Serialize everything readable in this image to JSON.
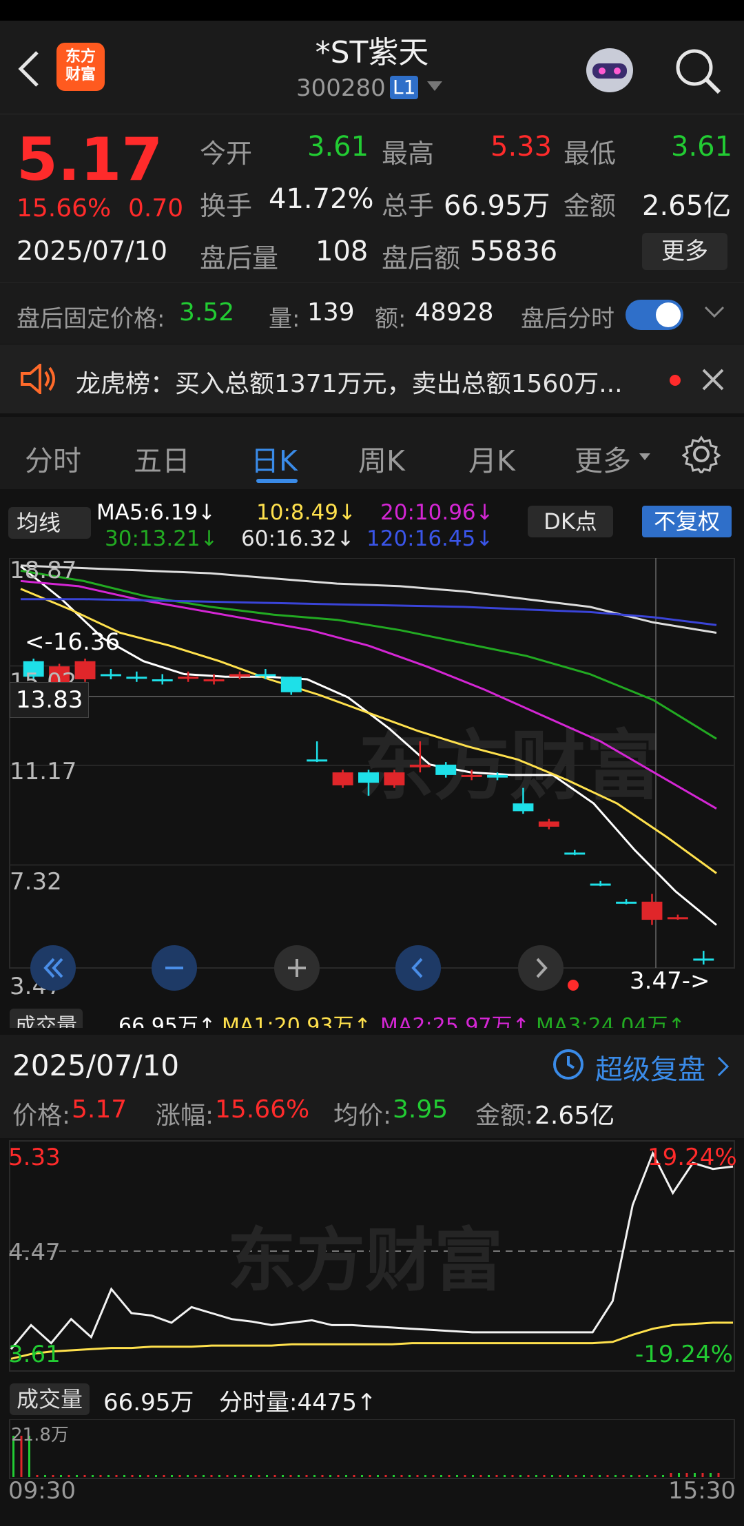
{
  "header": {
    "title": "*ST紫天",
    "code": "300280",
    "level_badge": "L1",
    "logo_text_1": "东方",
    "logo_text_2": "财富"
  },
  "quote": {
    "price": "5.17",
    "change_pct": "15.66%",
    "change_amt": "0.70",
    "date": "2025/07/10",
    "open_label": "今开",
    "open": "3.61",
    "high_label": "最高",
    "high": "5.33",
    "low_label": "最低",
    "low": "3.61",
    "turnover_label": "换手",
    "turnover": "41.72%",
    "volume_label": "总手",
    "volume": "66.95万",
    "amount_label": "金额",
    "amount": "2.65亿",
    "after_vol_label": "盘后量",
    "after_vol": "108",
    "after_amt_label": "盘后额",
    "after_amt": "55836",
    "more_button": "更多"
  },
  "after_hours": {
    "fixed_price_label": "盘后固定价格:",
    "fixed_price": "3.52",
    "vol_label": "量:",
    "vol": "139",
    "amt_label": "额:",
    "amt": "48928",
    "toggle_label": "盘后分时",
    "toggle_on": true
  },
  "notice": {
    "text": "龙虎榜：买入总额1371万元，卖出总额1560万..."
  },
  "tabs": [
    "分时",
    "五日",
    "日K",
    "周K",
    "月K",
    "更多"
  ],
  "active_tab": "日K",
  "ma_bar": {
    "selector": "均线",
    "ma5": "MA5:6.19↓",
    "ma10": "10:8.49↓",
    "ma20": "20:10.96↓",
    "ma30": "30:13.21↓",
    "ma60": "60:16.32↓",
    "ma120": "120:16.45↓",
    "dk_button": "DK点",
    "adjust_button": "不复权"
  },
  "kchart_axis": {
    "ticks": [
      "18.87",
      "15.02",
      "11.17",
      "7.32",
      "3.47"
    ],
    "crosshair_value": "13.83",
    "high_marker": "<-16.36",
    "low_marker": "3.47->"
  },
  "volume_bar": {
    "label": "成交量",
    "value": "66.95万↑",
    "ma1": "MA1:20.93万↑",
    "ma2": "MA2:25.97万↑",
    "ma3": "MA3:24.04万↑"
  },
  "intraday": {
    "date": "2025/07/10",
    "replay_label": "超级复盘",
    "price_label": "价格:",
    "price": "5.17",
    "chg_label": "涨幅:",
    "chg": "15.66%",
    "avg_label": "均价:",
    "avg": "3.95",
    "amt_label": "金额:",
    "amt": "2.65亿",
    "y_top": "5.33",
    "y_mid": "4.47",
    "y_bottom": "3.61",
    "pct_top": "19.24%",
    "pct_bottom": "-19.24%",
    "vol_label": "成交量",
    "vol": "66.95万",
    "tick_vol": "分时量:4475↑",
    "vol_max": "21.8万",
    "time_start": "09:30",
    "time_end": "15:30"
  },
  "colors": {
    "up": "#ff2b2b",
    "down": "#22cc33",
    "accent": "#3a7bd5",
    "ma5": "#ffffff",
    "ma10": "#ffe14d",
    "ma20": "#d426d4",
    "ma30": "#22aa22",
    "ma60": "#dddddd",
    "ma120": "#3a44d8"
  },
  "chart_data": {
    "type": "candlestick",
    "y_range": [
      3.47,
      18.87
    ],
    "candles": [
      {
        "o": 15.2,
        "c": 14.6,
        "h": 15.3,
        "l": 14.5,
        "dir": "down"
      },
      {
        "o": 14.3,
        "c": 15.0,
        "h": 15.1,
        "l": 14.2,
        "dir": "up"
      },
      {
        "o": 14.5,
        "c": 15.2,
        "h": 15.3,
        "l": 14.4,
        "dir": "up"
      },
      {
        "o": 14.7,
        "c": 14.7,
        "h": 14.9,
        "l": 14.5,
        "dir": "down"
      },
      {
        "o": 14.6,
        "c": 14.6,
        "h": 14.8,
        "l": 14.4,
        "dir": "down"
      },
      {
        "o": 14.5,
        "c": 14.5,
        "h": 14.7,
        "l": 14.3,
        "dir": "down"
      },
      {
        "o": 14.6,
        "c": 14.6,
        "h": 14.8,
        "l": 14.4,
        "dir": "up"
      },
      {
        "o": 14.5,
        "c": 14.5,
        "h": 14.7,
        "l": 14.3,
        "dir": "up"
      },
      {
        "o": 14.6,
        "c": 14.7,
        "h": 14.8,
        "l": 14.5,
        "dir": "up"
      },
      {
        "o": 14.7,
        "c": 14.7,
        "h": 14.9,
        "l": 14.5,
        "dir": "down"
      },
      {
        "o": 14.6,
        "c": 14.0,
        "h": 14.6,
        "l": 13.9,
        "dir": "down"
      },
      {
        "o": 11.4,
        "c": 11.4,
        "h": 12.1,
        "l": 11.3,
        "dir": "down"
      },
      {
        "o": 10.4,
        "c": 10.9,
        "h": 11.0,
        "l": 10.3,
        "dir": "up"
      },
      {
        "o": 10.9,
        "c": 10.5,
        "h": 11.0,
        "l": 10.0,
        "dir": "down"
      },
      {
        "o": 10.4,
        "c": 10.9,
        "h": 11.0,
        "l": 10.3,
        "dir": "up"
      },
      {
        "o": 11.1,
        "c": 11.2,
        "h": 12.1,
        "l": 10.9,
        "dir": "up"
      },
      {
        "o": 11.2,
        "c": 10.8,
        "h": 11.3,
        "l": 10.7,
        "dir": "down"
      },
      {
        "o": 10.8,
        "c": 10.8,
        "h": 11.0,
        "l": 10.6,
        "dir": "up"
      },
      {
        "o": 10.8,
        "c": 10.7,
        "h": 10.9,
        "l": 10.6,
        "dir": "down"
      },
      {
        "o": 9.7,
        "c": 9.4,
        "h": 10.3,
        "l": 9.3,
        "dir": "down"
      },
      {
        "o": 8.8,
        "c": 9.0,
        "h": 9.1,
        "l": 8.7,
        "dir": "up"
      },
      {
        "o": 7.8,
        "c": 7.8,
        "h": 7.9,
        "l": 7.7,
        "dir": "down"
      },
      {
        "o": 6.6,
        "c": 6.6,
        "h": 6.7,
        "l": 6.5,
        "dir": "down"
      },
      {
        "o": 5.9,
        "c": 5.9,
        "h": 6.0,
        "l": 5.8,
        "dir": "down"
      },
      {
        "o": 5.2,
        "c": 5.9,
        "h": 6.2,
        "l": 5.0,
        "dir": "up"
      },
      {
        "o": 5.3,
        "c": 5.3,
        "h": 5.4,
        "l": 5.2,
        "dir": "up"
      },
      {
        "o": 3.7,
        "c": 3.7,
        "h": 4.0,
        "l": 3.47,
        "dir": "down"
      }
    ],
    "ma_lines": {
      "ma5": [
        18.87,
        17.6,
        16.1,
        15.2,
        14.7,
        14.6,
        14.6,
        14.5,
        13.8,
        12.6,
        11.2,
        10.9,
        10.8,
        10.8,
        9.7,
        7.9,
        6.3,
        5.0
      ],
      "ma10": [
        18.0,
        17.2,
        16.3,
        15.8,
        15.2,
        14.5,
        13.9,
        13.2,
        12.5,
        11.9,
        11.4,
        10.6,
        9.7,
        8.4,
        7.0
      ],
      "ma20": [
        18.3,
        18.1,
        17.6,
        17.2,
        16.8,
        16.4,
        15.8,
        15.0,
        14.1,
        13.1,
        12.1,
        10.8,
        9.5
      ],
      "ma30": [
        18.7,
        18.3,
        17.7,
        17.3,
        17.0,
        16.8,
        16.4,
        15.9,
        15.4,
        14.7,
        13.7,
        12.2
      ],
      "ma60": [
        18.9,
        18.8,
        18.7,
        18.6,
        18.4,
        18.2,
        18.1,
        17.9,
        17.6,
        17.3,
        16.7,
        16.3
      ],
      "ma120": [
        17.6,
        17.6,
        17.55,
        17.5,
        17.45,
        17.4,
        17.35,
        17.3,
        17.2,
        17.1,
        16.9,
        16.6
      ]
    },
    "intraday_y_range": [
      3.61,
      5.33
    ],
    "intraday_price": [
      3.7,
      3.9,
      3.75,
      3.95,
      3.8,
      4.2,
      4.0,
      3.98,
      3.92,
      4.05,
      4.0,
      3.95,
      3.93,
      3.9,
      3.92,
      3.94,
      3.9,
      3.9,
      3.89,
      3.88,
      3.87,
      3.86,
      3.85,
      3.84,
      3.84,
      3.84,
      3.84,
      3.84,
      3.84,
      3.84,
      4.1,
      4.9,
      5.33,
      5.0,
      5.25,
      5.2,
      5.22
    ],
    "intraday_avg": [
      3.62,
      3.66,
      3.68,
      3.69,
      3.7,
      3.71,
      3.71,
      3.72,
      3.72,
      3.72,
      3.73,
      3.73,
      3.73,
      3.73,
      3.74,
      3.74,
      3.74,
      3.74,
      3.74,
      3.74,
      3.75,
      3.75,
      3.75,
      3.75,
      3.75,
      3.75,
      3.75,
      3.75,
      3.75,
      3.75,
      3.76,
      3.82,
      3.87,
      3.9,
      3.91,
      3.92,
      3.92
    ]
  }
}
